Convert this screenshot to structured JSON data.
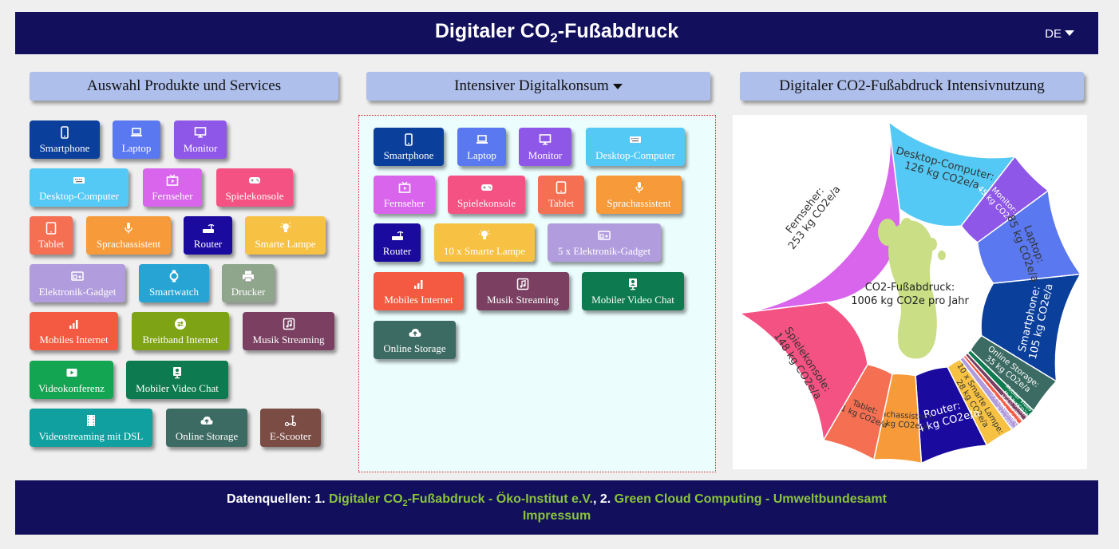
{
  "header": {
    "title_pre": "Digitaler CO",
    "title_sub": "2",
    "title_post": "-Fußabdruck",
    "lang": "DE"
  },
  "columns": {
    "left": "Auswahl Produkte und Services",
    "middle": "Intensiver Digitalkonsum",
    "right": "Digitaler CO2-Fußabdruck Intensivnutzung"
  },
  "catalog": [
    {
      "label": "Smartphone",
      "icon": "smartphone-icon",
      "color": "#0b3f9c"
    },
    {
      "label": "Laptop",
      "icon": "laptop-icon",
      "color": "#5a78ef"
    },
    {
      "label": "Monitor",
      "icon": "monitor-icon",
      "color": "#8e57e8"
    },
    {
      "label": "Desktop-Computer",
      "icon": "keyboard-icon",
      "color": "#55c9f5"
    },
    {
      "label": "Fernseher",
      "icon": "tv-icon",
      "color": "#d865eb"
    },
    {
      "label": "Spielekonsole",
      "icon": "gamepad-icon",
      "color": "#f45283"
    },
    {
      "label": "Tablet",
      "icon": "tablet-icon",
      "color": "#f56f52"
    },
    {
      "label": "Sprachassistent",
      "icon": "microphone-icon",
      "color": "#f79a3a"
    },
    {
      "label": "Router",
      "icon": "router-icon",
      "color": "#1a0a9e"
    },
    {
      "label": "Smarte Lampe",
      "icon": "lamp-icon",
      "color": "#f7c243"
    },
    {
      "label": "Elektronik-Gadget",
      "icon": "gadget-icon",
      "color": "#b19cdd"
    },
    {
      "label": "Smartwatch",
      "icon": "watch-icon",
      "color": "#27a4d3"
    },
    {
      "label": "Drucker",
      "icon": "printer-icon",
      "color": "#8fa68d"
    },
    {
      "label": "Mobiles Internet",
      "icon": "signal-icon",
      "color": "#f45a42"
    },
    {
      "label": "Breitband Internet",
      "icon": "exchange-icon",
      "color": "#7ea315"
    },
    {
      "label": "Musik Streaming",
      "icon": "music-icon",
      "color": "#7a3f61"
    },
    {
      "label": "Videokonferenz",
      "icon": "video-icon",
      "color": "#14a553"
    },
    {
      "label": "Mobiler Video Chat",
      "icon": "video-chat-icon",
      "color": "#0d7a4f"
    },
    {
      "label": "Videostreaming mit DSL",
      "icon": "film-icon",
      "color": "#11a0a0"
    },
    {
      "label": "Online Storage",
      "icon": "cloud-upload-icon",
      "color": "#3b6b62"
    },
    {
      "label": "E-Scooter",
      "icon": "scooter-icon",
      "color": "#7a4c44"
    }
  ],
  "selected": [
    {
      "label": "Smartphone",
      "icon": "smartphone-icon",
      "color": "#0b3f9c"
    },
    {
      "label": "Laptop",
      "icon": "laptop-icon",
      "color": "#5a78ef"
    },
    {
      "label": "Monitor",
      "icon": "monitor-icon",
      "color": "#8e57e8"
    },
    {
      "label": "Desktop-Computer",
      "icon": "keyboard-icon",
      "color": "#55c9f5"
    },
    {
      "label": "Fernseher",
      "icon": "tv-icon",
      "color": "#d865eb"
    },
    {
      "label": "Spielekonsole",
      "icon": "gamepad-icon",
      "color": "#f45283"
    },
    {
      "label": "Tablet",
      "icon": "tablet-icon",
      "color": "#f56f52"
    },
    {
      "label": "Sprachassistent",
      "icon": "microphone-icon",
      "color": "#f79a3a"
    },
    {
      "label": "Router",
      "icon": "router-icon",
      "color": "#1a0a9e"
    },
    {
      "label": "10 x Smarte Lampe",
      "icon": "lamp-icon",
      "color": "#f7c243"
    },
    {
      "label": "5 x Elektronik-Gadget",
      "icon": "gadget-icon",
      "color": "#b19cdd"
    },
    {
      "label": "Mobiles Internet",
      "icon": "signal-icon",
      "color": "#f45a42"
    },
    {
      "label": "Musik Streaming",
      "icon": "music-icon",
      "color": "#7a3f61"
    },
    {
      "label": "Mobiler Video Chat",
      "icon": "video-chat-icon",
      "color": "#0d7a4f"
    },
    {
      "label": "Online Storage",
      "icon": "cloud-upload-icon",
      "color": "#3b6b62"
    }
  ],
  "chart_data": {
    "type": "pie",
    "center_label": "CO2-Fußabdruck:",
    "center_value": "1006 kg CO2e pro Jahr",
    "unit": "kg CO2e/a",
    "start_category": "Smartphone",
    "slices": [
      {
        "name": "Smartphone",
        "value": 105,
        "color": "#0b3f9c",
        "text": "#ffffff"
      },
      {
        "name": "Online Storage",
        "value": 35,
        "color": "#3b6b62",
        "text": "#ffffff"
      },
      {
        "name": "Mobiler Video Chat",
        "value": 8,
        "color": "#0d7a4f",
        "text": "#ffffff"
      },
      {
        "name": "Musik Streaming",
        "value": 6,
        "color": "#7a3f61",
        "text": "#ffffff"
      },
      {
        "name": "Mobiles Internet",
        "value": 5,
        "color": "#f45a42",
        "text": "#ffffff"
      },
      {
        "name": "5 x Elektronik-Gadget",
        "value": 8,
        "color": "#b19cdd",
        "text": "#ffffff"
      },
      {
        "name": "10 x Smarte Lampe",
        "value": 28,
        "color": "#f7c243",
        "text": "#333333"
      },
      {
        "name": "Router",
        "value": 64,
        "color": "#1a0a9e",
        "text": "#ffffff"
      },
      {
        "name": "Sprachassistent",
        "value": 45,
        "color": "#f79a3a",
        "text": "#333333"
      },
      {
        "name": "Tablet",
        "value": 51,
        "color": "#f56f52",
        "text": "#333333"
      },
      {
        "name": "Spielekonsole",
        "value": 148,
        "color": "#f45283",
        "text": "#333333"
      },
      {
        "name": "Fernseher",
        "value": 253,
        "color": "#d865eb",
        "text": "#333333"
      },
      {
        "name": "Desktop-Computer",
        "value": 126,
        "color": "#55c9f5",
        "text": "#333333"
      },
      {
        "name": "Monitor",
        "value": 45,
        "color": "#8e57e8",
        "text": "#ffffff"
      },
      {
        "name": "Laptop",
        "value": 85,
        "color": "#5a78ef",
        "text": "#333333"
      }
    ],
    "footprint_color": "#c9de85"
  },
  "footer": {
    "prefix": "Datenquellen: 1. ",
    "source1_pre": "Digitaler CO",
    "source1_sub": "2",
    "source1_post": "-Fußabdruck - Öko-Institut e.V.",
    "sep": ", 2. ",
    "source2": "Green Cloud Computing - Umweltbundesamt",
    "impressum": "Impressum"
  }
}
